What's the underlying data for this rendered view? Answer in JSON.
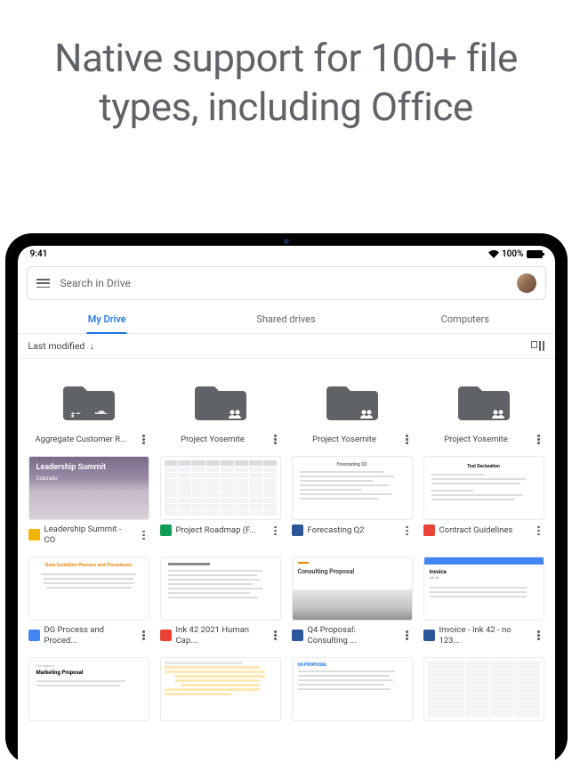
{
  "headline": "Native support for 100+ file types, including Office",
  "status": {
    "time": "9:41",
    "battery": "100%"
  },
  "search": {
    "placeholder": "Search in Drive"
  },
  "tabs": [
    {
      "label": "My Drive",
      "active": true
    },
    {
      "label": "Shared drives",
      "active": false
    },
    {
      "label": "Computers",
      "active": false
    }
  ],
  "filter": {
    "sort_label": "Last modified"
  },
  "folders": [
    {
      "name": "Aggregate Customer R..."
    },
    {
      "name": "Project Yosemite"
    },
    {
      "name": "Project Yosemite"
    },
    {
      "name": "Project Yosemite"
    }
  ],
  "files_row1": [
    {
      "name": "Leadership Summit - CO",
      "type": "slides",
      "thumb_title": "Leadership Summit",
      "thumb_sub": "Colorado"
    },
    {
      "name": "Project Roadmap (F...",
      "type": "sheets"
    },
    {
      "name": "Forecasting Q2",
      "type": "word",
      "thumb_title": "Forecasting Q2"
    },
    {
      "name": "Contract Guidelines",
      "type": "pdf",
      "thumb_title": "Test Declaration"
    }
  ],
  "files_row2": [
    {
      "name": "DG Process and Proced...",
      "type": "docs",
      "thumb_title": "Data Guideline Process and Procedures"
    },
    {
      "name": "Ink 42 2021 Human Cap...",
      "type": "pdf"
    },
    {
      "name": "Q4 Proposal: Consulting ...",
      "type": "word",
      "thumb_title": "Consulting Proposal"
    },
    {
      "name": "Invoice - Ink 42 - no 123...",
      "type": "word",
      "thumb_title": "Invoice",
      "thumb_sub": "Ink 42"
    }
  ],
  "files_row3": [
    {
      "name": "",
      "type": "docs",
      "thumb_sub": "The Agency",
      "thumb_title": "Marketing Proposal"
    },
    {
      "name": "",
      "type": "pdf"
    },
    {
      "name": "",
      "type": "word",
      "thumb_title": "Q4 PROPOSAL"
    },
    {
      "name": "",
      "type": "sheets"
    }
  ]
}
